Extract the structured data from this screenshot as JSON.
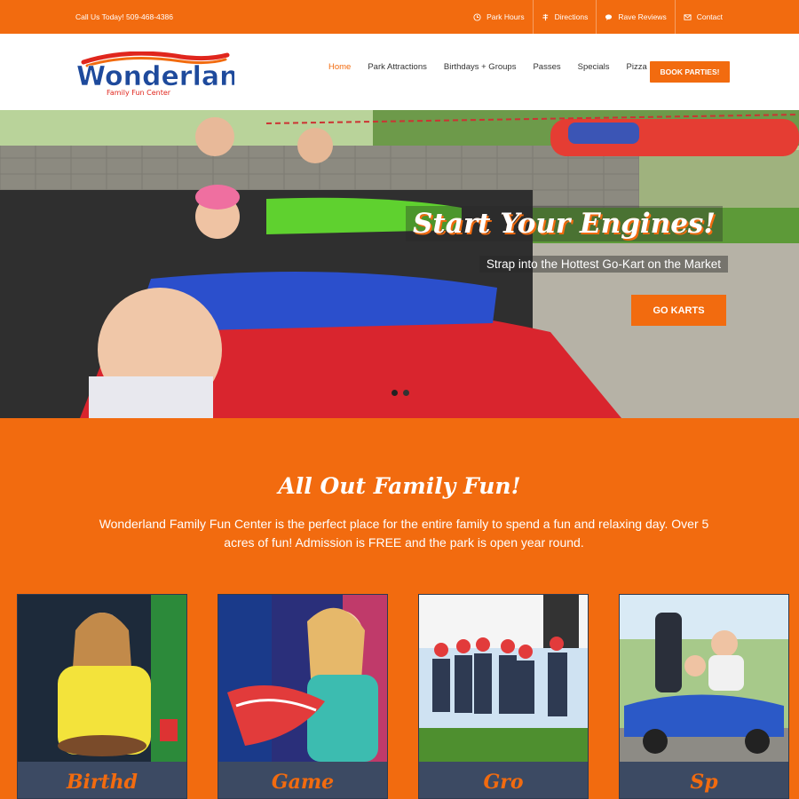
{
  "topbar": {
    "call": "Call Us Today! 509-468-4386",
    "links": [
      {
        "label": "Park Hours",
        "icon": "clock-icon"
      },
      {
        "label": "Directions",
        "icon": "signpost-icon"
      },
      {
        "label": "Rave Reviews",
        "icon": "chat-bubble-icon"
      },
      {
        "label": "Contact",
        "icon": "envelope-icon"
      }
    ]
  },
  "logo": {
    "name": "Wonderland",
    "tagline": "Family Fun Center"
  },
  "nav": {
    "items": [
      "Home",
      "Park Attractions",
      "Birthdays + Groups",
      "Passes",
      "Specials",
      "Pizza"
    ],
    "active": "Home",
    "book_button": "BOOK PARTIES!"
  },
  "hero": {
    "title": "Start Your Engines!",
    "subtitle": "Strap into the Hottest Go-Kart on the Market",
    "button": "GO KARTS",
    "slide_count": 2,
    "active_slide": 1
  },
  "intro": {
    "title": "All Out Family Fun!",
    "text": "Wonderland Family Fun Center is the perfect place for the entire family to spend a fun and relaxing day. Over 5 acres of fun! Admission is FREE and the park is open year round."
  },
  "cards": [
    {
      "title": "Birthd"
    },
    {
      "title": "Game"
    },
    {
      "title": "Gro"
    },
    {
      "title": "Sp"
    }
  ],
  "colors": {
    "accent": "#f26b0f",
    "card_bg": "#3c4a63",
    "logo_blue": "#1e4a9c",
    "logo_red": "#e0261d"
  }
}
